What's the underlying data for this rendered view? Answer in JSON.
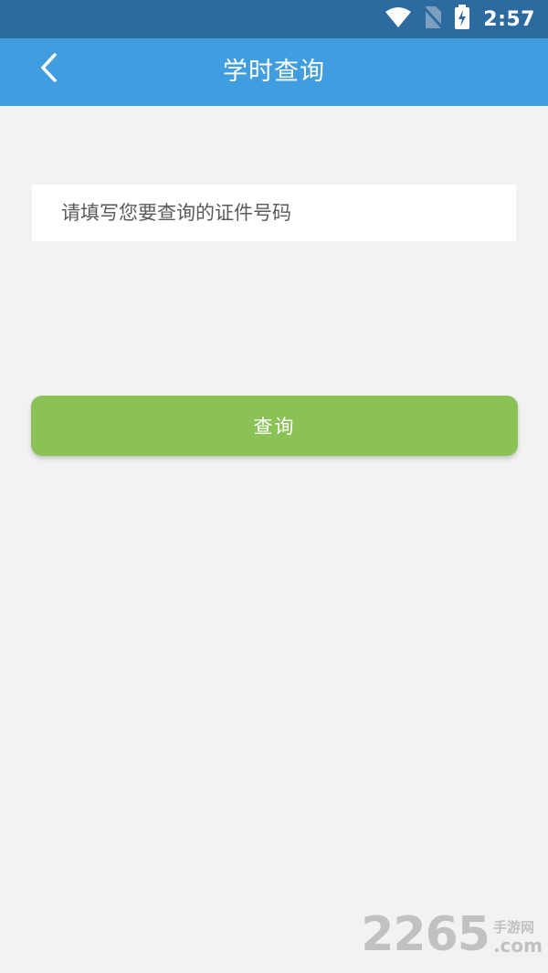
{
  "status_bar": {
    "time": "2:57",
    "icons": [
      "wifi-icon",
      "no-sim-icon",
      "battery-charging-icon"
    ]
  },
  "header": {
    "back_icon": "chevron-left-icon",
    "title": "学时查询"
  },
  "form": {
    "id_input": {
      "value": "",
      "placeholder": "请填写您要查询的证件号码"
    },
    "query_button_label": "查询"
  },
  "watermark": {
    "number": "2265",
    "site": "手游网",
    "domain": ".com"
  },
  "colors": {
    "status_bar": "#2d6aa0",
    "header": "#3f9de0",
    "background": "#f2f2f2",
    "button": "#8ac256"
  }
}
